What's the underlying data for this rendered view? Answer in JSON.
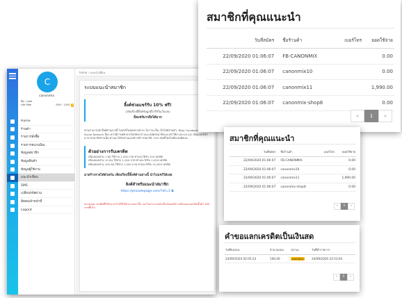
{
  "user": {
    "avatar_letter": "C",
    "name": "canonmix"
  },
  "plan": {
    "name_label": "ชื่อ",
    "name_value": "rival",
    "plan_label": "Life Plan",
    "sms_label": "SMS :",
    "sms_value": "1000",
    "badge": "3"
  },
  "sidebar": {
    "items": [
      {
        "label": "Home",
        "icon": "home-icon"
      },
      {
        "label": "ร้านค้า",
        "icon": "store-icon"
      },
      {
        "label": "รายการสั่งซื้อ",
        "icon": "cart-icon"
      },
      {
        "label": "รายการสแกนบิลเ..",
        "icon": "scan-icon"
      },
      {
        "label": "ข้อมูลสมาชิก",
        "icon": "users-icon"
      },
      {
        "label": "ข้อมูลสินค้า",
        "icon": "box-icon"
      },
      {
        "label": "ข้อมูลผู้ใช้งาน",
        "icon": "user-icon"
      },
      {
        "label": "แนะนำเพื่อน",
        "icon": "share-icon",
        "active": true
      },
      {
        "label": "SMS",
        "icon": "sms-icon"
      },
      {
        "label": "เปลี่ยนรหัสผ่าน",
        "icon": "key-icon"
      },
      {
        "label": "ติดต่อเจ้าหน้าที่",
        "icon": "support-icon"
      },
      {
        "label": "Logout",
        "icon": "logout-icon"
      }
    ]
  },
  "breadcrumb": {
    "home": "home",
    "sep": "›",
    "current": "แนะนำเพื่อน"
  },
  "invite": {
    "title": "ระบบแนะนำสมาชิก",
    "promo_title": "ลิ้งค์ช่วยแชร์รับ 10% ฟรี!",
    "promo_sub": "(เพียงก็อปปี้ลิ้งค์ข้อมูลนี้ไปใช้ในเว็บเลย)",
    "promo_cta": "ยิ่งแชร์มากยิ่งได้มาก",
    "desc": "ท่านสามารถนำลิ้งค์ด้านล่างนี้ ไปแชร์ในช่องทางต่างๆ ไม่ว่าจะเป็น เว็บไซต์ส่วนตัว, Blog, Facebook หรือ Social Network อื่นๆ หากมีการคลิกจากลิงก์ดังกล่าวและสมัครสมาชิกและเข้าใช้งานระบบ และ มีออเดอร์เข้ามาจากสมาชิกท่านนั้น ท่านจะได้รับส่วนแบ่งค่าบริการสมาชิก 10% ทันทีโดยไม่ต้องลงมือเอง",
    "example_title": "ตัวอย่างการรับเครดิต",
    "example_lines": [
      "เพื่อนของท่าน 1 คน ใช้จ่าย 1,000 บาท ท่านจะได้รับ 100 เครดิต",
      "เพื่อนของท่าน 10 คน ใช้จ่าย 1,000 บาท ท่านจะได้รับ 1,000 เครดิต",
      "เพื่อนของท่าน 100 คน ใช้จ่าย 1,000 บาท ท่านจะได้รับ 10,000 เครดิต"
    ],
    "share_line": "มาสร้างรายได้ด้วยกัน เพียงก๊อปปี้ลิ้งค์ด้านล่างนี้ นำไปแชร์ได้เลย",
    "link_title": "ลิงค์สำหรับแนะนำสมาชิก",
    "link_url": "https://prosalepage.com/?af=1",
    "note": "หมายเหตุ: เครดิตที่ได้รับจะนำไปใช้ได้กับระบบเท่านั้น และไม่สามารถเบิกเป็นเงินสดได้ กรณีขอถอนเครดิตขั้นต่ำ 300 บาทขึ้นไป"
  },
  "members": {
    "title": "สมาชิกที่คุณแนะนำ",
    "columns": [
      "วันที่สมัคร",
      "ชื่อร้านค้า",
      "เบอร์โทร",
      "ยอดใช้จ่าย"
    ],
    "rows": [
      [
        "22/09/2020 01:06:07",
        "FB-CANONMIX",
        "",
        "0.00"
      ],
      [
        "22/09/2020 01:06:07",
        "canonmix10",
        "",
        "0.00"
      ],
      [
        "22/09/2020 01:06:07",
        "canonmix11",
        "",
        "1,990.00"
      ],
      [
        "22/09/2020 01:06:07",
        "canonmix-shop8",
        "",
        "0.00"
      ]
    ],
    "pager": {
      "prev": "«",
      "page": "1",
      "next": "»"
    }
  },
  "withdraw": {
    "title": "คำขอแลกเครดิตเป็นเงินสด",
    "columns": [
      "วันที่ขอถอน",
      "จำนวนถอน",
      "สถานะ",
      "วันที่ทำรายการ"
    ],
    "rows": [
      [
        "24/09/2020 02:05:23",
        "100.00",
        "pending",
        "24/09/2020 22:53:04"
      ]
    ],
    "pager": {
      "prev": "«",
      "page": "1",
      "next": "»"
    }
  },
  "colors": {
    "rail_top": "#2f6fe0",
    "rail_bottom": "#19c3ea",
    "accent": "#1aa3e8",
    "badge": "#f4b400"
  }
}
